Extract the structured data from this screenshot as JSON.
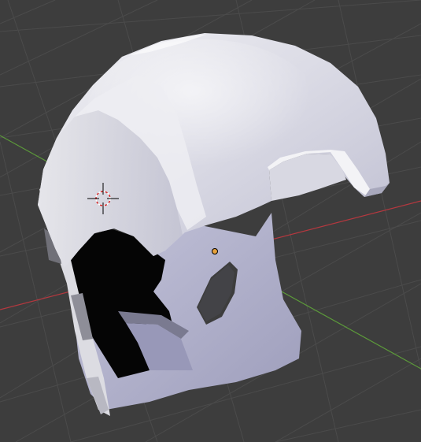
{
  "viewport": {
    "background_color": "#3d3d3d",
    "grid_color": "#4a4a4a",
    "x_axis_color": "#b5383f",
    "y_axis_color": "#5c9a3a"
  },
  "scene": {
    "object": "helmet-mesh",
    "object_colors": {
      "shell_light": "#e4e4ea",
      "shell_mid": "#c9c9d6",
      "shell_shadow": "#a9a9bd",
      "lower_face": "#b7b7d0",
      "cavity": "#050505"
    },
    "origin_color": "#e6a13a",
    "cursor_colors": [
      "#d72b2b",
      "#ffffff",
      "#000000"
    ]
  }
}
